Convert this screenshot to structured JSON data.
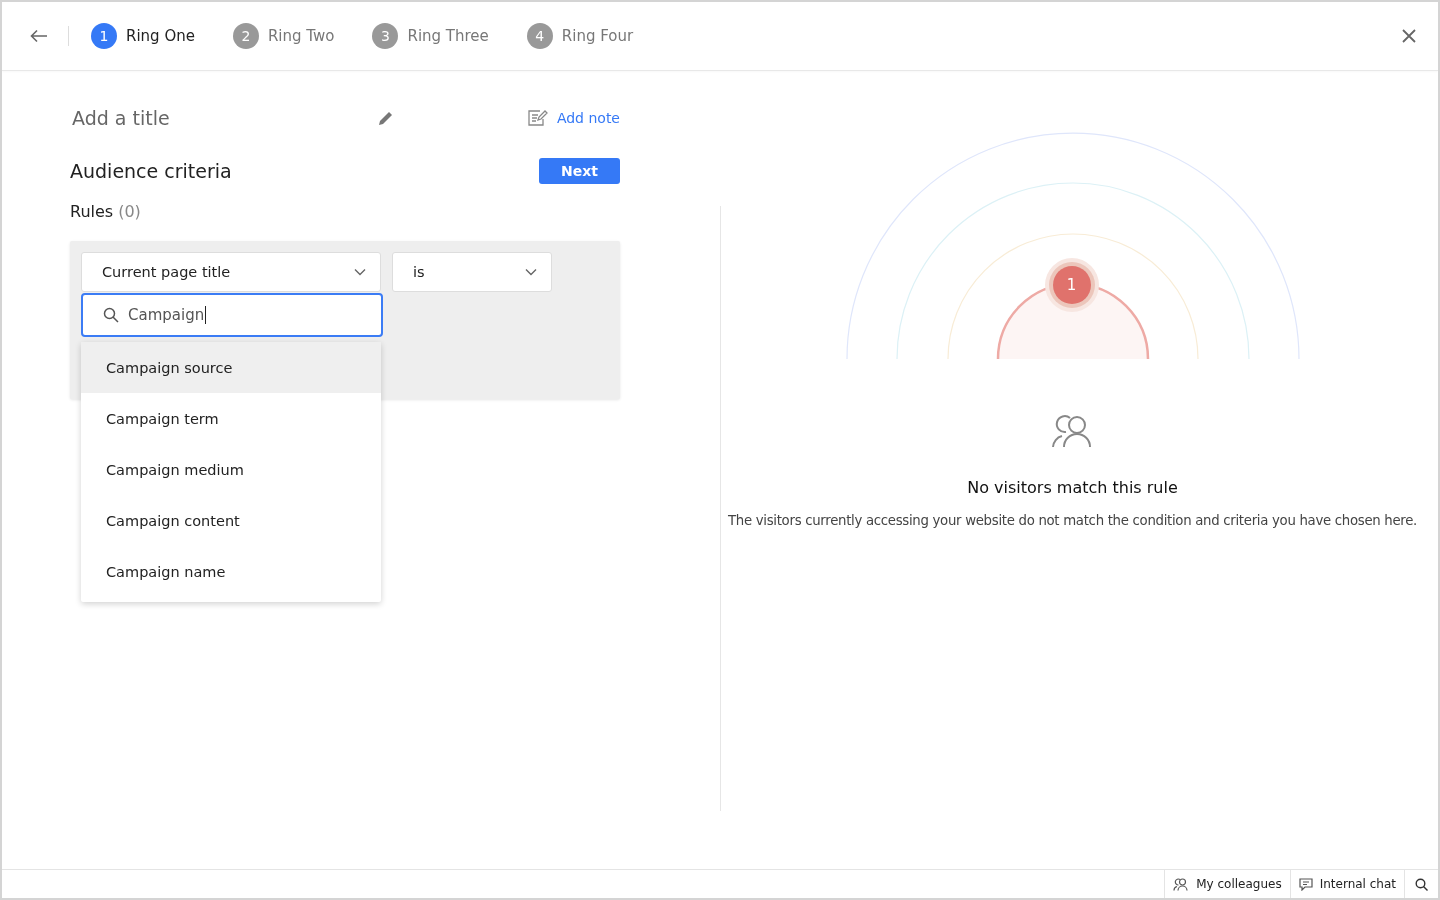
{
  "steps": [
    {
      "number": "1",
      "label": "Ring One",
      "selected": true
    },
    {
      "number": "2",
      "label": "Ring Two",
      "selected": false
    },
    {
      "number": "3",
      "label": "Ring Three",
      "selected": false
    },
    {
      "number": "4",
      "label": "Ring Four",
      "selected": false
    }
  ],
  "title_placeholder": "Add a title",
  "add_note": "Add note",
  "heading": "Audience criteria",
  "next_button": "Next",
  "rules": {
    "label": "Rules",
    "count": "(0)"
  },
  "rule": {
    "field": "Current page title",
    "operator": "is",
    "search": "Campaign",
    "options": [
      {
        "label": "Campaign source",
        "selected": true
      },
      {
        "label": "Campaign term",
        "selected": false
      },
      {
        "label": "Campaign medium",
        "selected": false
      },
      {
        "label": "Campaign content",
        "selected": false
      },
      {
        "label": "Campaign name",
        "selected": false
      }
    ]
  },
  "visitor_badge": "1",
  "empty_title": "No visitors match this rule",
  "empty_description": "The visitors currently accessing your website do not match the condition and criteria you have chosen here.",
  "footer": [
    {
      "kind": "colleagues",
      "label": "My colleagues"
    },
    {
      "kind": "chat",
      "label": "Internal chat"
    }
  ]
}
